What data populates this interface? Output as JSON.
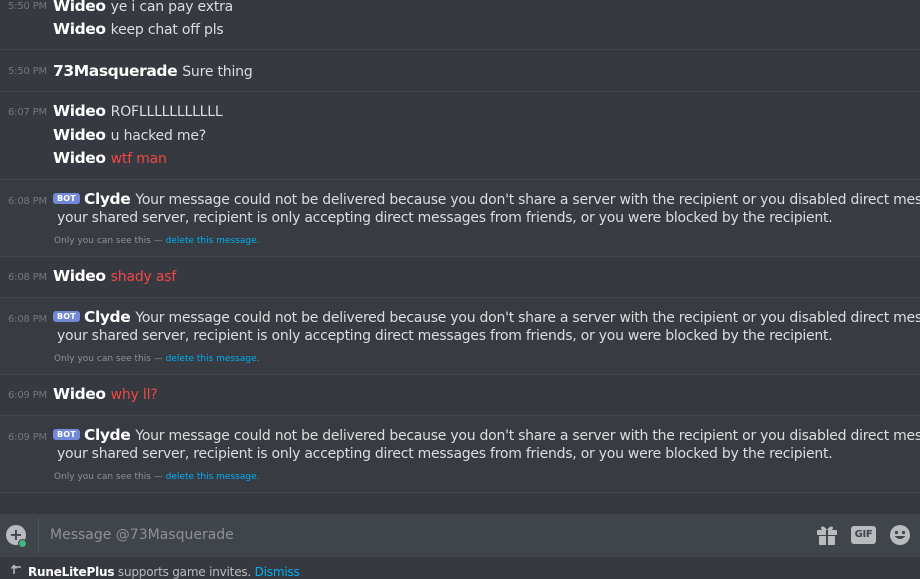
{
  "messages": {
    "g1": {
      "timestamp": "5:50 PM",
      "lines": [
        {
          "author": "Wideo",
          "text": "ye i can pay extra"
        },
        {
          "author": "Wideo",
          "text": "keep chat off pls"
        }
      ]
    },
    "g2": {
      "timestamp": "5:50 PM",
      "author": "73Masquerade",
      "text": "Sure thing"
    },
    "g3": {
      "timestamp": "6:07 PM",
      "lines": [
        {
          "author": "Wideo",
          "text": "ROFLLLLLLLLLLL"
        },
        {
          "author": "Wideo",
          "text": "u hacked me?"
        },
        {
          "author": "Wideo",
          "text": "wtf man"
        }
      ]
    },
    "g4": {
      "timestamp": "6:08 PM",
      "badge": "BOT",
      "author": "Clyde",
      "line1": "Your message could not be delivered because you don't share a server with the recipient or you disabled direct messages on",
      "line2": "your shared server, recipient is only accepting direct messages from friends, or you were blocked by the recipient.",
      "note": "Only you can see this — ",
      "note_link": "delete this message."
    },
    "g5": {
      "timestamp": "6:08 PM",
      "author": "Wideo",
      "text": "shady asf"
    },
    "g6": {
      "timestamp": "6:08 PM",
      "badge": "BOT",
      "author": "Clyde",
      "line1": "Your message could not be delivered because you don't share a server with the recipient or you disabled direct messages on",
      "line2": "your shared server, recipient is only accepting direct messages from friends, or you were blocked by the recipient.",
      "note": "Only you can see this — ",
      "note_link": "delete this message."
    },
    "g7": {
      "timestamp": "6:09 PM",
      "author": "Wideo",
      "text": "why ll?"
    },
    "g8": {
      "timestamp": "6:09 PM",
      "badge": "BOT",
      "author": "Clyde",
      "line1": "Your message could not be delivered because you don't share a server with the recipient or you disabled direct messages on",
      "line2": "your shared server, recipient is only accepting direct messages from friends, or you were blocked by the recipient.",
      "note": "Only you can see this — ",
      "note_link": "delete this message."
    }
  },
  "composer": {
    "placeholder": "Message @73Masquerade",
    "gif_label": "GIF",
    "icons": [
      "add-attachment-icon",
      "gift-icon",
      "gif-icon",
      "emoji-icon"
    ]
  },
  "footer": {
    "app": "RuneLitePlus",
    "text": " supports game invites. ",
    "dismiss": "Dismiss"
  },
  "colors": {
    "background": "#36393f",
    "composer": "#40444b",
    "error_text": "#f04747",
    "link": "#00b0f4",
    "bot_badge": "#7289da"
  }
}
